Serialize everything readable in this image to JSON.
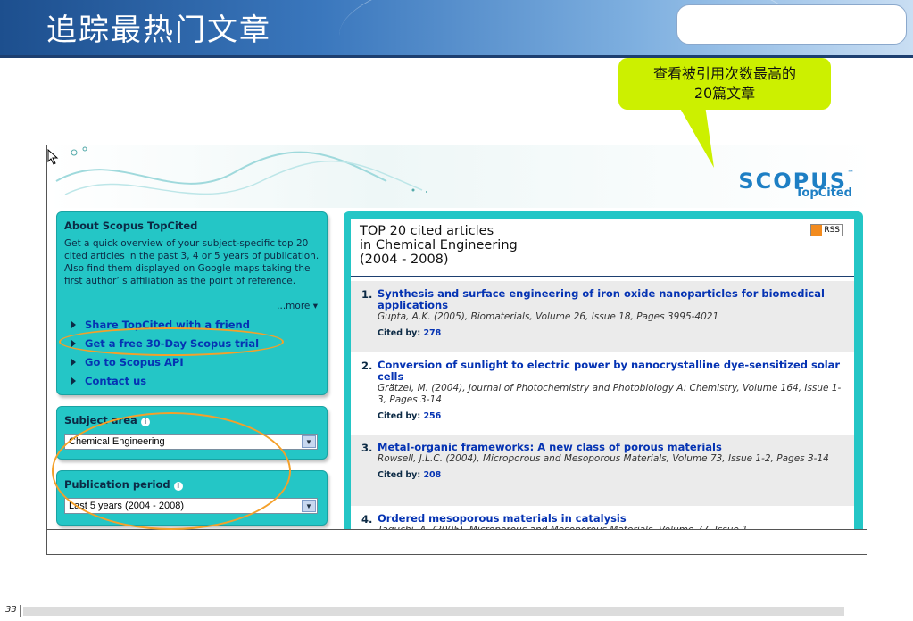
{
  "slide": {
    "title": "追踪最热门文章",
    "page_number": "33"
  },
  "callout": {
    "line1": "查看被引用次数最高的",
    "line2": "20篇文章"
  },
  "brand": {
    "logo": "SCOPUS",
    "trademark": "™",
    "subtitle": "TopCited"
  },
  "about": {
    "title": "About Scopus TopCited",
    "text": "Get a quick overview of your subject-specific top 20 cited articles in the past 3, 4 or 5 years of publication. Also find them displayed on Google maps taking the first author’ s affiliation as the point of reference.",
    "more_label": "...more",
    "links": [
      "Share TopCited with a friend",
      "Get a free 30-Day Scopus trial",
      "Go to Scopus API",
      "Contact us"
    ]
  },
  "subject": {
    "title": "Subject area",
    "selected": "Chemical Engineering"
  },
  "period": {
    "title": "Publication period",
    "selected": "Last 5 years (2004 - 2008)"
  },
  "results": {
    "heading_line1": "TOP 20 cited articles",
    "heading_line2": "in Chemical Engineering",
    "heading_line3": "(2004 - 2008)",
    "rss_label": "RSS",
    "cited_by_label": "Cited by:",
    "articles": [
      {
        "num": "1.",
        "title": "Synthesis and surface engineering of iron oxide nanoparticles for biomedical applications",
        "citation": "Gupta, A.K. (2005), Biomaterials, Volume 26, Issue 18, Pages 3995-4021",
        "cited": "278"
      },
      {
        "num": "2.",
        "title": "Conversion of sunlight to electric power by nanocrystalline dye-sensitized solar cells",
        "citation": "Grätzel, M. (2004), Journal of Photochemistry and Photobiology A: Chemistry, Volume 164, Issue 1-3, Pages 3-14",
        "cited": "256"
      },
      {
        "num": "3.",
        "title": "Metal-organic frameworks: A new class of porous materials",
        "citation": "Rowsell, J.L.C. (2004), Microporous and Mesoporous Materials, Volume 73, Issue 1-2, Pages 3-14",
        "cited": "208"
      },
      {
        "num": "4.",
        "title": "Ordered mesoporous materials in catalysis",
        "citation": "Taguchi, A. (2005), Microporous and Mesoporous Materials, Volume 77, Issue 1,",
        "cited": ""
      }
    ]
  },
  "colors": {
    "panel_teal": "#24c6c6",
    "link_blue": "#0533b3",
    "callout_green": "#ccf000",
    "highlight_orange": "#f4a02a"
  }
}
